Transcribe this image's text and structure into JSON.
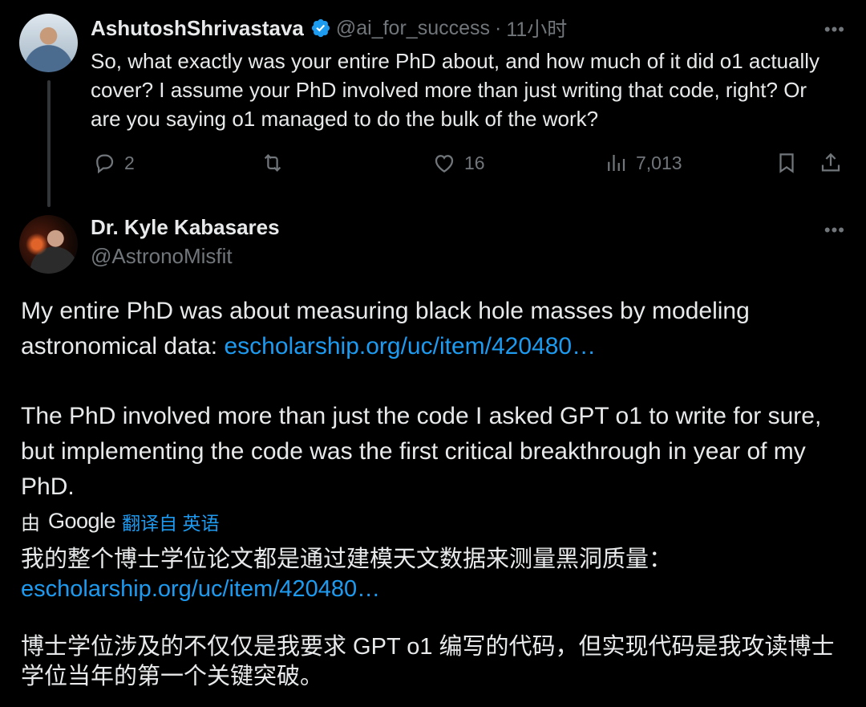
{
  "parent_tweet": {
    "author_name": "AshutoshShrivastava",
    "handle": "@ai_for_success",
    "separator": "·",
    "time": "11小时",
    "text": "So, what exactly was your entire PhD about, and how much of it did o1 actually cover? I assume your PhD involved more than just writing that code, right? Or are you saying o1 managed to do the bulk of the work?",
    "reply_count": "2",
    "like_count": "16",
    "view_count": "7,013"
  },
  "main_tweet": {
    "author_name": "Dr. Kyle Kabasares",
    "handle": "@AstronoMisfit",
    "para1_text": "My entire PhD was about measuring black hole masses by modeling astronomical data: ",
    "para1_link": "escholarship.org/uc/item/420480…",
    "para2_text": "The PhD involved more than just the code I asked GPT o1 to write for sure, but implementing the code was the first critical breakthrough in year of my PhD."
  },
  "translation": {
    "by_label": "由",
    "google_label": "Google",
    "translated_from": "翻译自 英语",
    "zh_para1": "我的整个博士学位论文都是通过建模天文数据来测量黑洞质量：",
    "zh_link": "escholarship.org/uc/item/420480…",
    "zh_para2": "博士学位涉及的不仅仅是我要求 GPT o1 编写的代码，但实现代码是我攻读博士学位当年的第一个关键突破。"
  },
  "icons": [
    "verified-badge-icon",
    "more-icon",
    "reply-icon",
    "retweet-icon",
    "like-icon",
    "views-icon",
    "bookmark-icon",
    "share-icon"
  ],
  "colors": {
    "background": "#000000",
    "text": "#e7e9ea",
    "muted": "#71767b",
    "link": "#1d9bf0",
    "verified": "#1d9bf0"
  }
}
